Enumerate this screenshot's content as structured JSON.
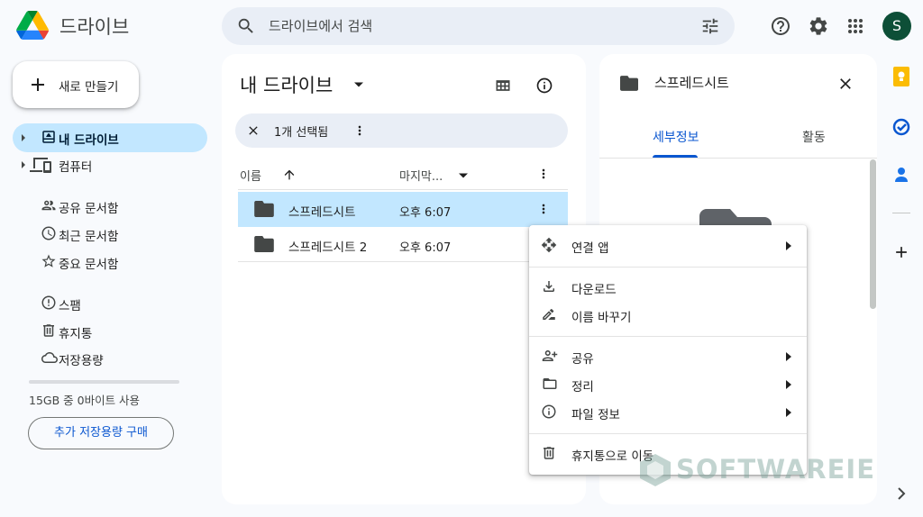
{
  "app": {
    "title": "드라이브"
  },
  "search": {
    "placeholder": "드라이브에서 검색"
  },
  "header": {
    "avatar_letter": "S"
  },
  "sidebar": {
    "new_label": "새로 만들기",
    "items": [
      {
        "label": "내 드라이브",
        "icon": "my-drive-icon",
        "active": true
      },
      {
        "label": "컴퓨터",
        "icon": "computer-icon"
      },
      {
        "label": "공유 문서함",
        "icon": "shared-people-icon"
      },
      {
        "label": "최근 문서함",
        "icon": "clock-icon"
      },
      {
        "label": "중요 문서함",
        "icon": "star-icon"
      },
      {
        "label": "스팸",
        "icon": "spam-icon"
      },
      {
        "label": "휴지통",
        "icon": "trash-icon"
      },
      {
        "label": "저장용량",
        "icon": "cloud-icon"
      }
    ],
    "storage_text": "15GB 중 0바이트 사용",
    "storage_used_fraction": 0,
    "buy_storage_label": "추가 저장용량 구매"
  },
  "main": {
    "title": "내 드라이브",
    "selection_label": "1개 선택됨",
    "columns": {
      "name": "이름",
      "modified": "마지막..."
    },
    "files": [
      {
        "name": "스프레드시트",
        "time": "오후 6:07",
        "selected": true
      },
      {
        "name": "스프레드시트 2",
        "time": "오후 6:07",
        "selected": false
      }
    ]
  },
  "details": {
    "title": "스프레드시트",
    "tabs": [
      "세부정보",
      "활동"
    ]
  },
  "context_menu": {
    "groups": [
      [
        {
          "label": "연결 앱",
          "icon": "open-with-icon",
          "submenu": true
        }
      ],
      [
        {
          "label": "다운로드",
          "icon": "download-icon"
        },
        {
          "label": "이름 바꾸기",
          "icon": "rename-icon"
        }
      ],
      [
        {
          "label": "공유",
          "icon": "share-person-icon",
          "submenu": true
        },
        {
          "label": "정리",
          "icon": "organize-folder-icon",
          "submenu": true
        },
        {
          "label": "파일 정보",
          "icon": "info-icon",
          "submenu": true
        }
      ],
      [
        {
          "label": "휴지통으로 이동",
          "icon": "trash-icon"
        }
      ]
    ]
  },
  "watermark": {
    "text": "SOFTWAREIE"
  },
  "colors": {
    "accent": "#0b57d0",
    "selected_bg": "#c2e7ff",
    "page_bg": "#f8fafd",
    "search_bg": "#e9eef6",
    "avatar_bg": "#0d4f37"
  }
}
